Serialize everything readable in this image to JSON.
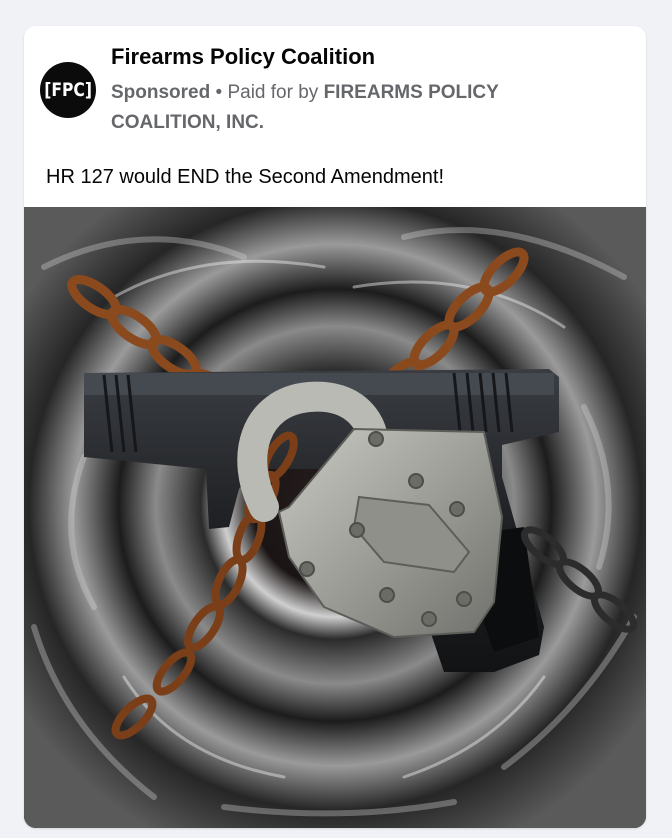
{
  "post": {
    "avatar_text": "[FPC]",
    "page_name": "Firearms Policy Coalition",
    "sponsored_label": "Sponsored",
    "separator": "•",
    "paid_prefix": "Paid for by",
    "paid_by": "FIREARMS POLICY COALITION, INC.",
    "body_text": "HR 127 would END the Second Amendment!",
    "image_subject": "padlocked-chained-pistol-image"
  },
  "colors": {
    "name": "#050505",
    "meta": "#65676b",
    "background": "#f0f2f5",
    "card": "#ffffff",
    "rust": "#8b4a1e",
    "lock": "#a6a7a1"
  }
}
